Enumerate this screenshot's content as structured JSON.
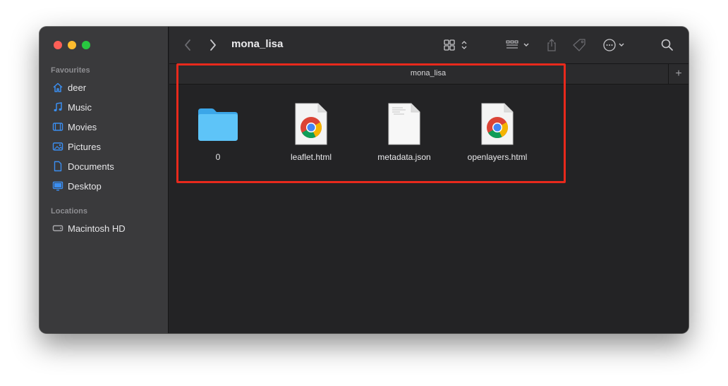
{
  "window": {
    "title": "mona_lisa"
  },
  "sidebar": {
    "favourites_heading": "Favourites",
    "favourites": [
      {
        "label": "deer",
        "icon": "home-icon"
      },
      {
        "label": "Music",
        "icon": "music-note-icon"
      },
      {
        "label": "Movies",
        "icon": "film-icon"
      },
      {
        "label": "Pictures",
        "icon": "photo-icon"
      },
      {
        "label": "Documents",
        "icon": "document-icon"
      },
      {
        "label": "Desktop",
        "icon": "desktop-icon"
      }
    ],
    "locations_heading": "Locations",
    "locations": [
      {
        "label": "Macintosh HD",
        "icon": "hard-drive-icon"
      }
    ]
  },
  "toolbar": {
    "icons": [
      "back-icon",
      "forward-icon",
      "grid-view-icon",
      "group-icon",
      "share-icon",
      "tag-icon",
      "more-icon",
      "search-icon"
    ]
  },
  "tab": {
    "label": "mona_lisa",
    "add": "+"
  },
  "files": [
    {
      "name": "0",
      "icon": "folder-icon"
    },
    {
      "name": "leaflet.html",
      "icon": "chrome-html-icon"
    },
    {
      "name": "metadata.json",
      "icon": "json-file-icon"
    },
    {
      "name": "openlayers.html",
      "icon": "chrome-html-icon"
    }
  ],
  "colors": {
    "accent": "#4a90e2",
    "highlight": "#e8291c",
    "folder": "#5ac8fa"
  }
}
